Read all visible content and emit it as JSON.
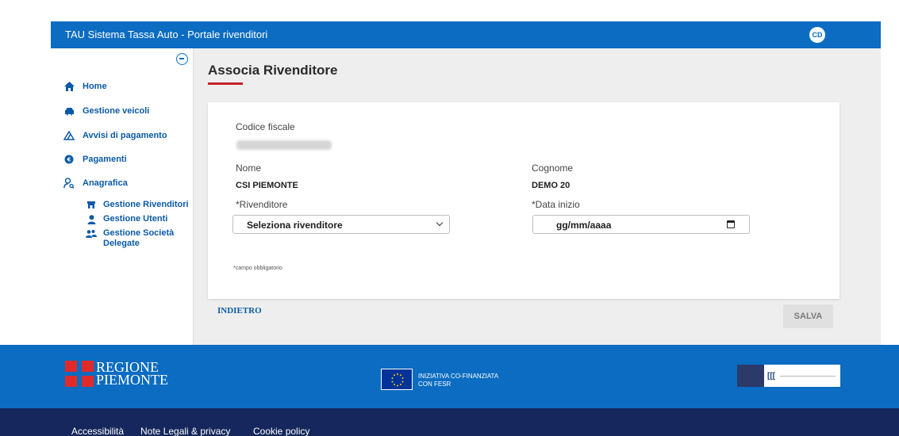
{
  "header": {
    "app_title": "TAU Sistema Tassa Auto - Portale rivenditori",
    "user_initials": "CD"
  },
  "sidebar": {
    "items": [
      {
        "label": "Home",
        "icon": "home-icon"
      },
      {
        "label": "Gestione veicoli",
        "icon": "car-icon"
      },
      {
        "label": "Avvisi di pagamento",
        "icon": "warning-icon"
      },
      {
        "label": "Pagamenti",
        "icon": "payment-icon"
      },
      {
        "label": "Anagrafica",
        "icon": "user-search-icon"
      }
    ],
    "sub_items": [
      {
        "label": "Gestione Rivenditori",
        "icon": "store-icon"
      },
      {
        "label": "Gestione Utenti",
        "icon": "user-icon"
      },
      {
        "label": "Gestione Società Delegate",
        "icon": "users-group-icon"
      }
    ]
  },
  "main": {
    "title": "Associa Rivenditore",
    "form": {
      "codice_fiscale_label": "Codice fiscale",
      "nome_label": "Nome",
      "nome_value": "CSI PIEMONTE",
      "cognome_label": "Cognome",
      "cognome_value": "DEMO 20",
      "rivenditore_label": "*Rivenditore",
      "rivenditore_value": "Seleziona rivenditore",
      "data_inizio_label": "*Data inizio",
      "data_inizio_placeholder": "gg/mm/aaaa",
      "required_note": "*campo obbligatorio"
    },
    "back_label": "INDIETRO",
    "save_label": "SALVA"
  },
  "footer": {
    "region_logo_line1": "REGIONE",
    "region_logo_line2": "PIEMONTE",
    "eu_line1": "INIZIATIVA CO-FINANZIATA",
    "eu_line2": "CON FESR",
    "links": [
      "Accessibilità",
      "Note Legali & privacy",
      "Cookie policy"
    ]
  },
  "colors": {
    "primary": "#0b6cc1",
    "nav_text": "#0a5aa6",
    "accent_red": "#c8202a",
    "footer_dark": "#15275c",
    "content_bg": "#eeeeee"
  }
}
